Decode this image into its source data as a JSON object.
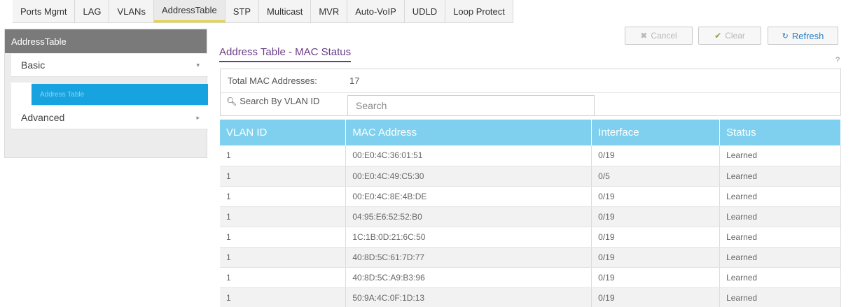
{
  "tabs": [
    {
      "label": "Ports Mgmt"
    },
    {
      "label": "LAG"
    },
    {
      "label": "VLANs"
    },
    {
      "label": "AddressTable",
      "active": true
    },
    {
      "label": "STP"
    },
    {
      "label": "Multicast"
    },
    {
      "label": "MVR"
    },
    {
      "label": "Auto-VoIP"
    },
    {
      "label": "UDLD"
    },
    {
      "label": "Loop Protect"
    }
  ],
  "sidebar": {
    "title": "AddressTable",
    "items": [
      {
        "label": "Basic",
        "caret": "▾"
      },
      {
        "label": "Address Table"
      },
      {
        "label": "Advanced",
        "caret": "▸"
      }
    ]
  },
  "buttons": {
    "cancel": "Cancel",
    "clear": "Clear",
    "refresh": "Refresh"
  },
  "page": {
    "title": "Address Table - MAC Status",
    "help": "?"
  },
  "summary": {
    "total_label": "Total MAC Addresses:",
    "total_value": "17"
  },
  "search": {
    "label": "Search By VLAN ID",
    "placeholder": "Search"
  },
  "table": {
    "headers": [
      "VLAN ID",
      "MAC Address",
      "Interface",
      "Status"
    ],
    "rows": [
      [
        "1",
        "00:E0:4C:36:01:51",
        "0/19",
        "Learned"
      ],
      [
        "1",
        "00:E0:4C:49:C5:30",
        "0/5",
        "Learned"
      ],
      [
        "1",
        "00:E0:4C:8E:4B:DE",
        "0/19",
        "Learned"
      ],
      [
        "1",
        "04:95:E6:52:52:B0",
        "0/19",
        "Learned"
      ],
      [
        "1",
        "1C:1B:0D:21:6C:50",
        "0/19",
        "Learned"
      ],
      [
        "1",
        "40:8D:5C:61:7D:77",
        "0/19",
        "Learned"
      ],
      [
        "1",
        "40:8D:5C:A9:B3:96",
        "0/19",
        "Learned"
      ],
      [
        "1",
        "50:9A:4C:0F:1D:13",
        "0/19",
        "Learned"
      ]
    ]
  },
  "icons": {
    "cancel": "close-icon",
    "clear": "check-icon",
    "refresh": "refresh-icon",
    "search": "search-icon"
  }
}
